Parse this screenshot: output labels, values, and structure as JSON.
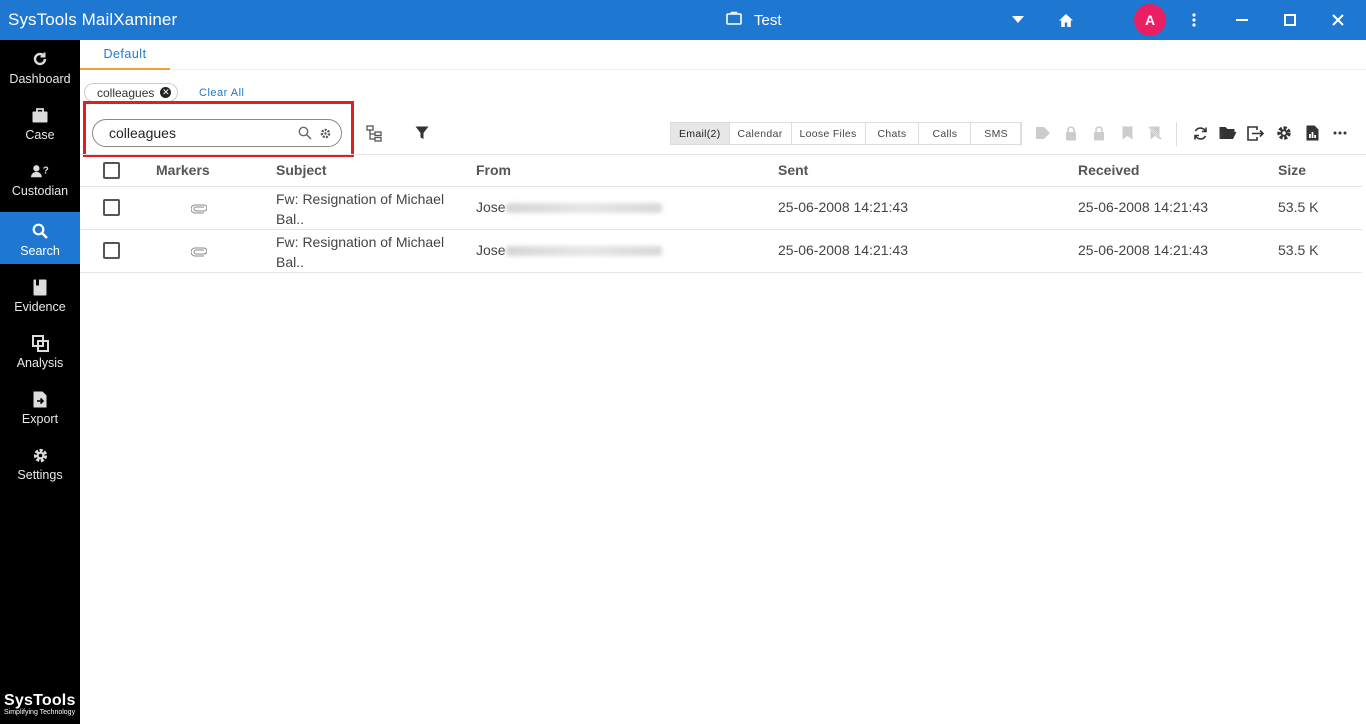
{
  "app": {
    "title": "SysTools MailXaminer",
    "case_name": "Test",
    "avatar_letter": "A"
  },
  "sidebar": {
    "items": [
      {
        "label": "Dashboard",
        "icon": "refresh-icon"
      },
      {
        "label": "Case",
        "icon": "briefcase-icon"
      },
      {
        "label": "Custodian",
        "icon": "custodian-icon"
      },
      {
        "label": "Search",
        "icon": "search-icon",
        "active": true
      },
      {
        "label": "Evidence",
        "icon": "evidence-icon"
      },
      {
        "label": "Analysis",
        "icon": "analysis-icon"
      },
      {
        "label": "Export",
        "icon": "export-icon"
      },
      {
        "label": "Settings",
        "icon": "gear-icon"
      }
    ],
    "brand": {
      "name": "SysTools",
      "tagline": "Simplifying Technology"
    }
  },
  "main": {
    "tab": "Default",
    "chip": "colleagues",
    "clear_all": "Clear All",
    "search": {
      "value": "colleagues"
    },
    "type_tabs": [
      {
        "label": "Email(2)",
        "active": true
      },
      {
        "label": "Calendar"
      },
      {
        "label": "Loose Files"
      },
      {
        "label": "Chats"
      },
      {
        "label": "Calls"
      },
      {
        "label": "SMS"
      }
    ]
  },
  "table": {
    "columns": {
      "markers": "Markers",
      "subject": "Subject",
      "from": "From",
      "sent": "Sent",
      "received": "Received",
      "size": "Size"
    },
    "rows": [
      {
        "subject_1": "Fw: Resignation of Michael",
        "subject_2": "Bal..",
        "from": "Jose",
        "sent": "25-06-2008 14:21:43",
        "received": "25-06-2008 14:21:43",
        "size": "53.5 K"
      },
      {
        "subject_1": "Fw: Resignation of Michael",
        "subject_2": "Bal..",
        "from": "Jose",
        "sent": "25-06-2008 14:21:43",
        "received": "25-06-2008 14:21:43",
        "size": "53.5 K"
      }
    ]
  },
  "colors": {
    "primary": "#1e78d2",
    "sidebar_bg": "#000000",
    "avatar": "#e91e63",
    "highlight": "#e01e1e",
    "tab_underline": "#f0a030"
  }
}
